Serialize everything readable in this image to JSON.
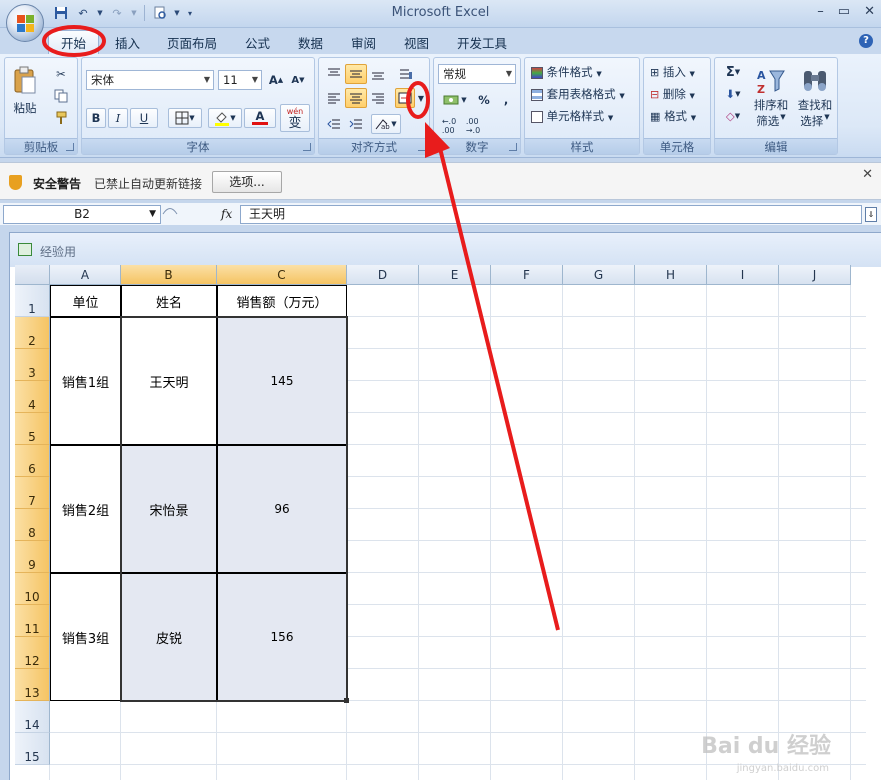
{
  "app": {
    "title": "Microsoft Excel"
  },
  "qat": {
    "icons": [
      "save-icon",
      "undo-icon",
      "redo-icon",
      "print-preview-icon"
    ]
  },
  "tabs": [
    {
      "label": "开始",
      "active": true
    },
    {
      "label": "插入"
    },
    {
      "label": "页面布局"
    },
    {
      "label": "公式"
    },
    {
      "label": "数据"
    },
    {
      "label": "审阅"
    },
    {
      "label": "视图"
    },
    {
      "label": "开发工具"
    }
  ],
  "ribbon": {
    "clipboard": {
      "label": "剪贴板",
      "paste": "粘贴"
    },
    "font": {
      "label": "字体",
      "name": "宋体",
      "size": "11",
      "bold": "B",
      "italic": "I",
      "underline": "U",
      "wen": "wén",
      "bian": "变"
    },
    "align": {
      "label": "对齐方式"
    },
    "number": {
      "label": "数字",
      "format": "常规",
      "percent": "%",
      "comma": ","
    },
    "styles": {
      "label": "样式",
      "cond": "条件格式",
      "table": "套用表格格式",
      "cell": "单元格样式"
    },
    "cells": {
      "label": "单元格",
      "insert": "插入",
      "delete": "删除",
      "format": "格式"
    },
    "edit": {
      "label": "编辑",
      "sigma": "Σ",
      "sort": "排序和",
      "sort2": "筛选",
      "find": "查找和",
      "find2": "选择"
    }
  },
  "security": {
    "title": "安全警告",
    "text": "已禁止自动更新链接",
    "button": "选项..."
  },
  "formula": {
    "namebox": "B2",
    "fx": "fx",
    "value": "王天明"
  },
  "workbook": {
    "name": "经验用"
  },
  "columns": [
    "A",
    "B",
    "C",
    "D",
    "E",
    "F",
    "G",
    "H",
    "I",
    "J"
  ],
  "rows": [
    "1",
    "2",
    "3",
    "4",
    "5",
    "6",
    "7",
    "8",
    "9",
    "10",
    "11",
    "12",
    "13",
    "14",
    "15"
  ],
  "table": {
    "headers": [
      "单位",
      "姓名",
      "销售额（万元）"
    ],
    "groups": [
      {
        "unit": "销售1组",
        "name": "王天明",
        "sales": "145"
      },
      {
        "unit": "销售2组",
        "name": "宋怡景",
        "sales": "96"
      },
      {
        "unit": "销售3组",
        "name": "皮锐",
        "sales": "156"
      }
    ]
  },
  "watermark": {
    "text": "Bai du 经验",
    "url": "jingyan.baidu.com"
  },
  "colors": {
    "selected_header": "#f5c463",
    "selected_range": "#e4e8f2",
    "annotation": "#e81c1c"
  }
}
